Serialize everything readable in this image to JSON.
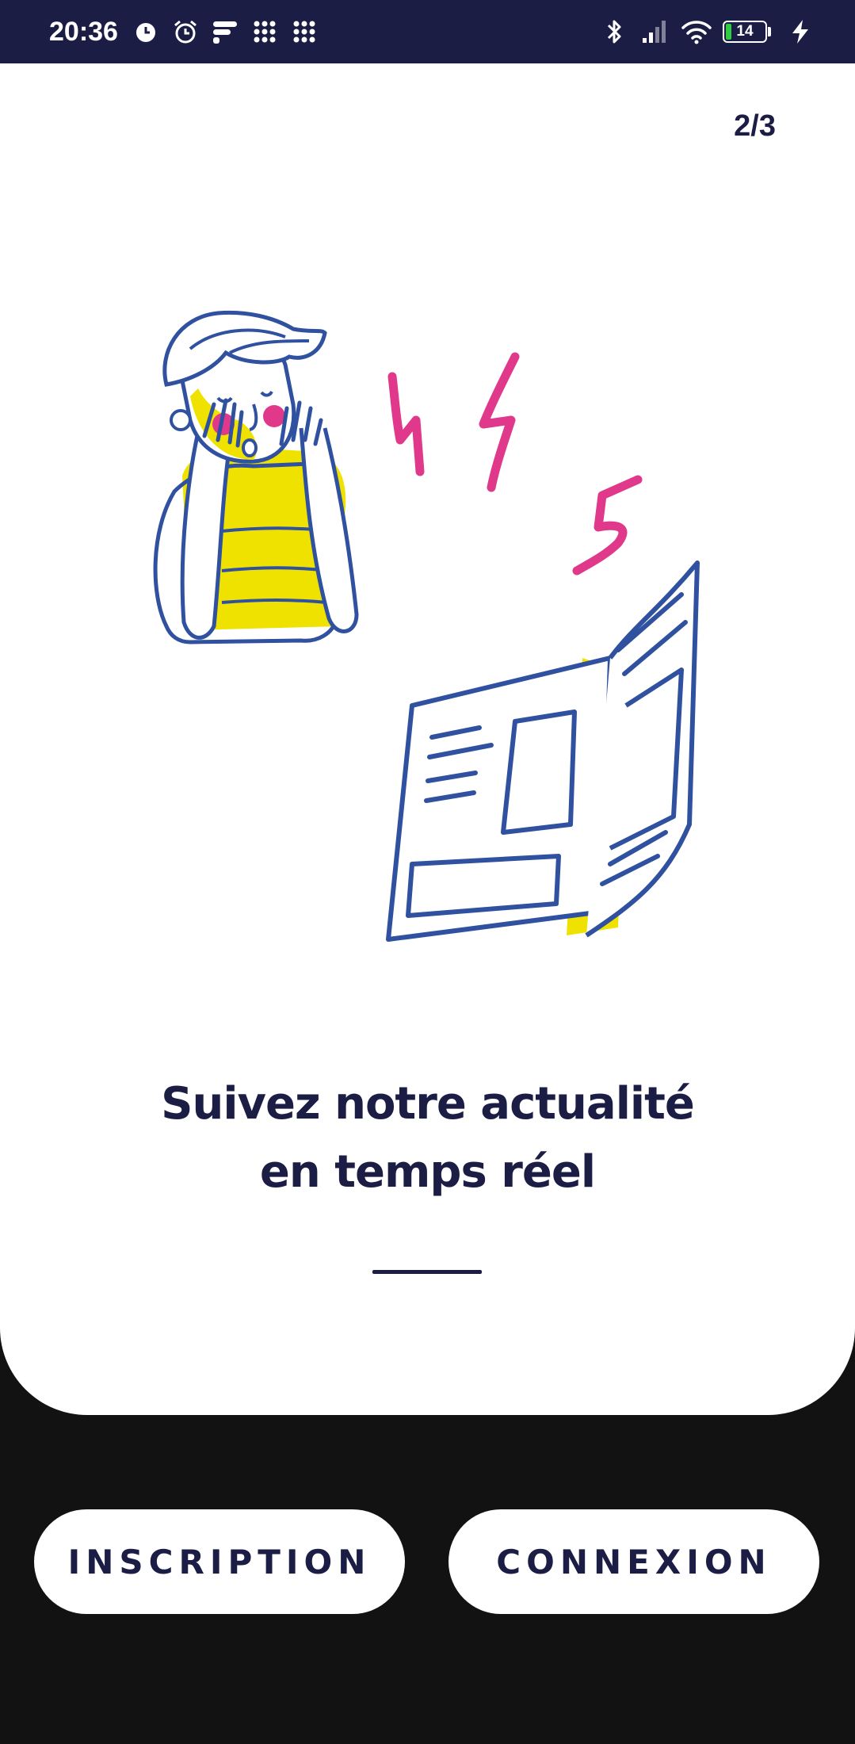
{
  "status_bar": {
    "time": "20:36",
    "battery_level": "14",
    "left_icons": [
      "alarm-filled-icon",
      "alarm-clock-icon",
      "app-notification-icon",
      "grid-dots-icon",
      "grid-dots-icon"
    ],
    "right_icons": [
      "bluetooth-icon",
      "signal-icon",
      "wifi-icon",
      "battery-icon",
      "charging-icon"
    ],
    "colors": {
      "background": "#1b1d45",
      "battery_fill": "#2ecc40"
    }
  },
  "onboarding": {
    "page_indicator": "2/3",
    "headline_line1": "Suivez notre actualité",
    "headline_line2": "en temps réel",
    "illustration": "surprised-person-reading-newspaper",
    "colors": {
      "ink": "#1b1d45",
      "illustration_blue": "#2f51a0",
      "illustration_yellow": "#f0e200",
      "illustration_pink": "#e0388a"
    }
  },
  "actions": {
    "inscription_label": "INSCRIPTION",
    "connexion_label": "CONNEXION"
  }
}
